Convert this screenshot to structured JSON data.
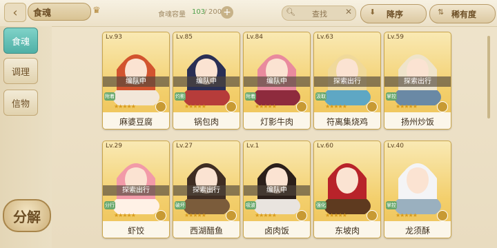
{
  "header": {
    "back_icon": "back-arrow-icon",
    "title": "食魂",
    "capacity_label": "食魂容量",
    "capacity_current": "103",
    "capacity_sep": "/",
    "capacity_max": "200",
    "add_icon": "plus-icon",
    "search_placeholder": "查找",
    "search_icon": "search-icon",
    "clear_icon": "close-icon",
    "sort_order_label": "降序",
    "sort_order_icon": "down-arrow-icon",
    "sort_by_label": "稀有度",
    "sort_by_icon": "swap-arrows-icon"
  },
  "sidebar": {
    "tabs": [
      {
        "label": "食魂",
        "active": true
      },
      {
        "label": "调理",
        "active": false
      },
      {
        "label": "信物",
        "active": false
      }
    ],
    "dismantle_label": "分解"
  },
  "cards": [
    {
      "level": "Lv.93",
      "status": "编队中",
      "tag": "附着",
      "stars": "★★★★★",
      "name": "麻婆豆腐"
    },
    {
      "level": "Lv.85",
      "status": "编队中",
      "tag": "灼影",
      "stars": "★★★★★",
      "name": "锅包肉"
    },
    {
      "level": "Lv.84",
      "status": "编队中",
      "tag": "附着",
      "stars": "★★★★★",
      "name": "灯影牛肉"
    },
    {
      "level": "Lv.63",
      "status": "探索出行",
      "tag": "汲取",
      "stars": "★★★★★",
      "name": "符离集烧鸡"
    },
    {
      "level": "Lv.59",
      "status": "探索出行",
      "tag": "掌控",
      "stars": "★★★★★",
      "name": "扬州炒饭"
    },
    {
      "level": "Lv.29",
      "status": "探索出行",
      "tag": "分行",
      "stars": "★★★★★",
      "name": "虾饺"
    },
    {
      "level": "Lv.27",
      "status": "探索出行",
      "tag": "破坏",
      "stars": "★★★★★",
      "name": "西湖醋鱼"
    },
    {
      "level": "Lv.1",
      "status": "编队中",
      "tag": "吸波",
      "stars": "★★★★★",
      "name": "卤肉饭"
    },
    {
      "level": "Lv.60",
      "status": "",
      "tag": "强化",
      "stars": "★★★★★",
      "name": "东坡肉"
    },
    {
      "level": "Lv.40",
      "status": "",
      "tag": "掌控",
      "stars": "★★★★★",
      "name": "龙须酥"
    }
  ]
}
